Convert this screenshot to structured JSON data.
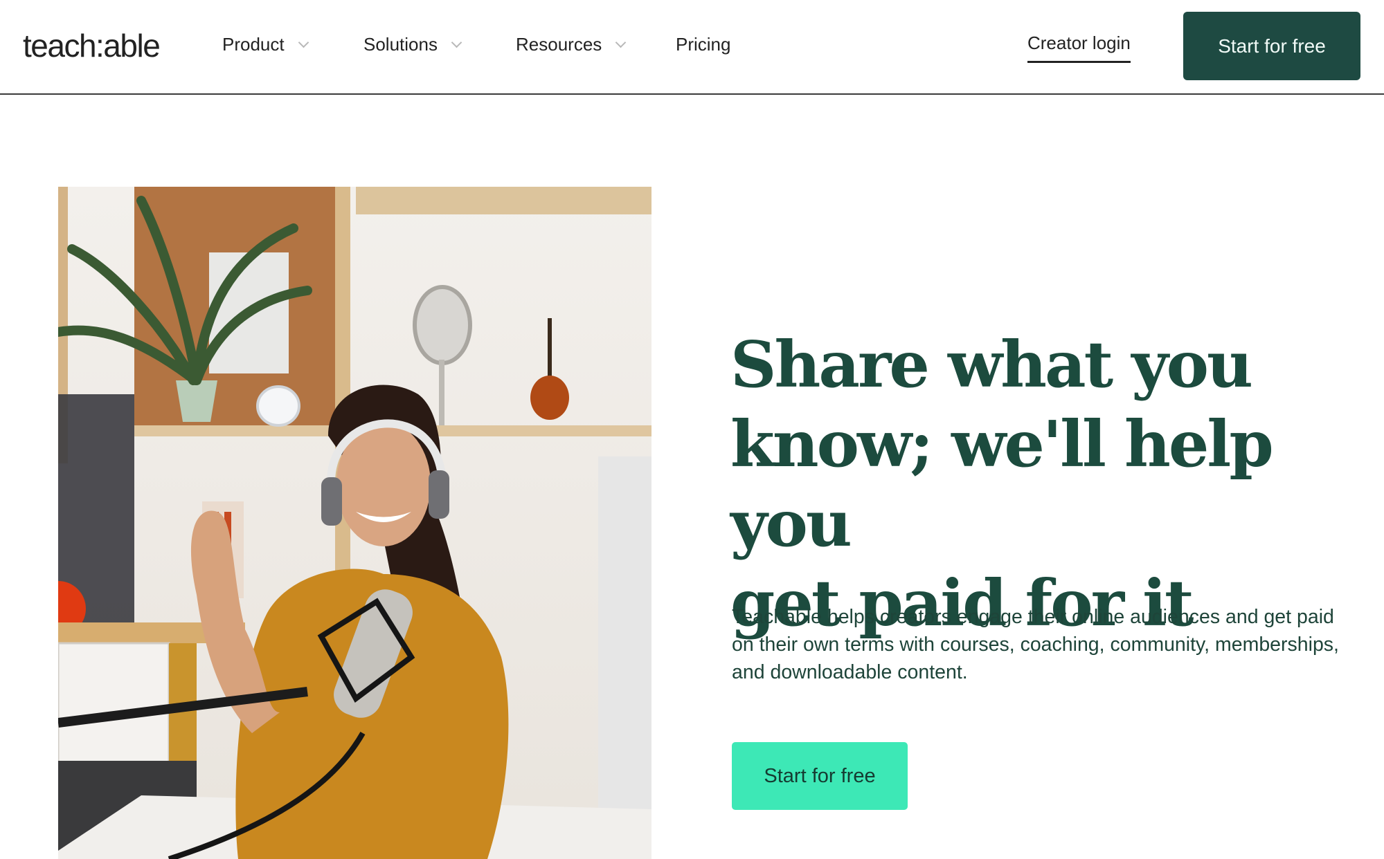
{
  "header": {
    "logo": "teach:able",
    "nav": [
      {
        "label": "Product",
        "has_dropdown": true
      },
      {
        "label": "Solutions",
        "has_dropdown": true
      },
      {
        "label": "Resources",
        "has_dropdown": true
      },
      {
        "label": "Pricing",
        "has_dropdown": false
      }
    ],
    "login_label": "Creator login",
    "cta_label": "Start for free"
  },
  "hero": {
    "image_alt": "Smiling woman wearing headphones and a mustard shirt speaking into a studio microphone in a bright home office",
    "title_lines": [
      "Share what you",
      "know; we'll help you",
      "get paid for it"
    ],
    "description": "Teachable helps creators engage their online audiences and get paid on their own terms with courses, coaching, community, memberships, and downloadable content.",
    "cta_label": "Start for free"
  },
  "colors": {
    "brand_dark": "#1e4a42",
    "accent": "#3de8b6",
    "heading": "#1c4b3e"
  }
}
